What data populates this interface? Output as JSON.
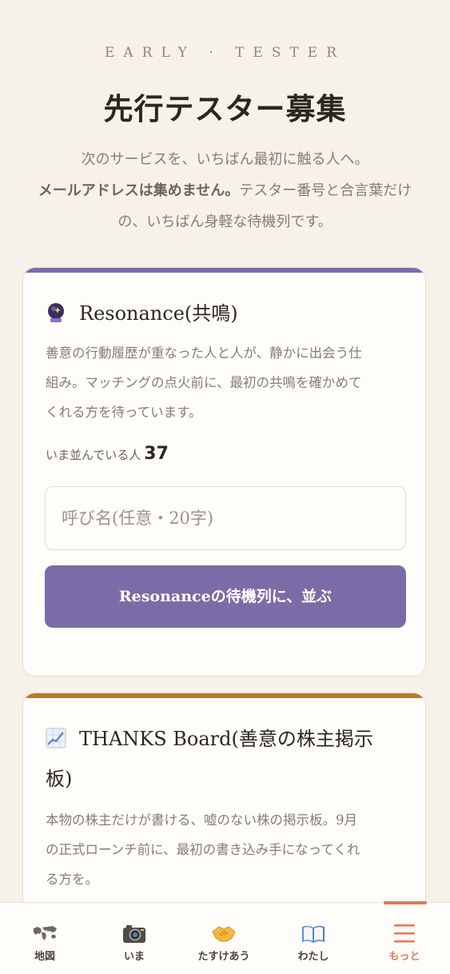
{
  "header": {
    "eyebrow": "EARLY · TESTER",
    "title": "先行テスター募集",
    "intro_line1": "次のサービスを、いちばん最初に触る人へ。",
    "intro_bold": "メールアドレスは集めません。",
    "intro_rest1": "テスター番号と合言葉だけ",
    "intro_line3": "の、いちばん身軽な待機列です。"
  },
  "cards": [
    {
      "accent": "#7a6ca6",
      "icon": "crystal-ball-icon",
      "title": "Resonance(共鳴)",
      "desc_line1": "善意の行動履歴が重なった人と人が、静かに出会う仕",
      "desc_line2": "組み。マッチングの点火前に、最初の共鳴を確かめて",
      "desc_line3": "くれる方を待っています。",
      "count_label": "いま並んでいる人",
      "count_value": "37",
      "input_placeholder": "呼び名(任意・20字)",
      "button_label": "Resonanceの待機列に、並ぶ"
    },
    {
      "accent": "#b57a2b",
      "icon": "chart-increasing-icon",
      "title_line1": "THANKS Board(善意の株主掲示",
      "title_line2": "板)",
      "desc_line1": "本物の株主だけが書ける、嘘のない株の掲示板。9月",
      "desc_line2": "の正式ローンチ前に、最初の書き込み手になってくれ",
      "desc_line3": "る方を。"
    }
  ],
  "bottom_nav": {
    "items": [
      {
        "label": "地図",
        "icon": "world-map-icon"
      },
      {
        "label": "いま",
        "icon": "camera-icon"
      },
      {
        "label": "たすけあう",
        "icon": "handshake-icon"
      },
      {
        "label": "わたし",
        "icon": "open-book-icon"
      },
      {
        "label": "もっと",
        "icon": "menu-icon",
        "active": true
      }
    ],
    "active_color": "#e0785a"
  }
}
